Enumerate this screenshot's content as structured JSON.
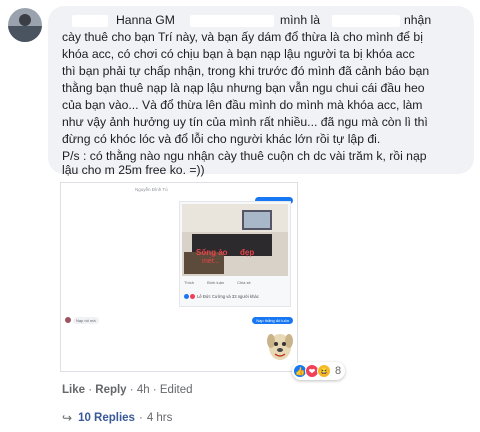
{
  "comment": {
    "lines": [
      "Hanna GM",
      "mình là",
      "nhận",
      "cày thuê cho bạn Trí này, và bạn ấy dám đổ thừa là cho mình để bị",
      "khóa acc, có chơi có chịu bạn à bạn nạp lậu người ta bị khóa acc",
      "thì bạn phải tự chấp nhận, trong khi trước đó mình đã cảnh báo bạn",
      "thằng bạn thuê nạp là nạp lậu nhưng bạn vẫn ngu chui cái đầu heo",
      "của bạn vào... Và đổ thừa lên đầu mình do mình mà khóa acc, làm",
      "như vậy ảnh hưởng uy tín của mình rất nhiều... đã ngu mà còn lì thì",
      "đừng có khóc lóc và đổ lỗi cho người khác lớn rồi tự lập đi.",
      "P/s : có thằng nào ngu nhận cày thuê cuộn ch dc vài trăm k, rồi nạp",
      "lậu cho m 25m free ko. =))"
    ]
  },
  "screenshot": {
    "top_caption": "Nguyễn Đình Tú",
    "photo_overlay": [
      "Sống ảo",
      "đẹp",
      "mét..."
    ],
    "post_actions": [
      "Thích",
      "Bình luận",
      "Chia sẻ"
    ],
    "post_reactions": "Lê Đức Cường và 33 người khác",
    "msg_left": "Nạp rồi mà",
    "msg_right": "Nạp thằng đó luôn"
  },
  "reactions": {
    "count": "8",
    "icons": [
      "like-reaction",
      "love-reaction",
      "haha-reaction"
    ],
    "colors": {
      "like": "#1877f2",
      "love": "#f33e58",
      "haha": "#f7b928"
    }
  },
  "actions": {
    "like": "Like",
    "reply": "Reply",
    "time": "4h",
    "edited": "Edited",
    "sep": "·"
  },
  "replies": {
    "label": "10 Replies",
    "time": "4 hrs",
    "sep": "·"
  }
}
